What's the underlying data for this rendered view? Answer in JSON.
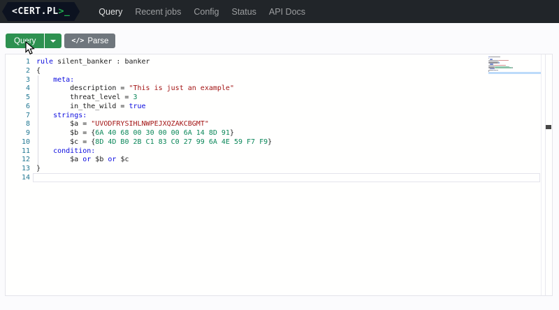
{
  "navbar": {
    "logo": {
      "prefix": "<",
      "brand": "CERT.PL",
      "suffix": ">",
      "cursor_char": "_"
    },
    "links": [
      {
        "label": "Query",
        "active": true
      },
      {
        "label": "Recent jobs",
        "active": false
      },
      {
        "label": "Config",
        "active": false
      },
      {
        "label": "Status",
        "active": false
      },
      {
        "label": "API Docs",
        "active": false
      }
    ]
  },
  "toolbar": {
    "query_label": "Query",
    "parse_label": "Parse",
    "parse_icon": "</>"
  },
  "colors": {
    "navbar_bg": "#212529",
    "logo_bg": "#0c1220",
    "logo_accent_green": "#1fae4e",
    "query_button_green": "#2d9150",
    "parse_button_gray": "#6f767d",
    "keyword": "#0a0adf",
    "string": "#a31515",
    "number": "#098658",
    "line_number": "#237893"
  },
  "editor": {
    "language": "yara",
    "line_count": 14,
    "lines": [
      {
        "n": 1,
        "tokens": [
          {
            "t": "rule",
            "c": "kw"
          },
          {
            "t": " silent_banker : banker",
            "c": "def"
          }
        ]
      },
      {
        "n": 2,
        "tokens": [
          {
            "t": "{",
            "c": "def"
          }
        ]
      },
      {
        "n": 3,
        "tokens": [
          {
            "t": "    ",
            "c": "def"
          },
          {
            "t": "meta:",
            "c": "kw"
          }
        ]
      },
      {
        "n": 4,
        "tokens": [
          {
            "t": "        description = ",
            "c": "def"
          },
          {
            "t": "\"This is just an example\"",
            "c": "str"
          }
        ]
      },
      {
        "n": 5,
        "tokens": [
          {
            "t": "        threat_level = ",
            "c": "def"
          },
          {
            "t": "3",
            "c": "num"
          }
        ]
      },
      {
        "n": 6,
        "tokens": [
          {
            "t": "        in_the_wild = ",
            "c": "def"
          },
          {
            "t": "true",
            "c": "kw"
          }
        ]
      },
      {
        "n": 7,
        "tokens": [
          {
            "t": "    ",
            "c": "def"
          },
          {
            "t": "strings:",
            "c": "kw"
          }
        ]
      },
      {
        "n": 8,
        "tokens": [
          {
            "t": "        $a = ",
            "c": "def"
          },
          {
            "t": "\"UVODFRYSIHLNWPEJXQZAKCBGMT\"",
            "c": "str"
          }
        ]
      },
      {
        "n": 9,
        "tokens": [
          {
            "t": "        $b = {",
            "c": "def"
          },
          {
            "t": "6A 40 68 00 30 00 00 6A 14 8D 91",
            "c": "num"
          },
          {
            "t": "}",
            "c": "def"
          }
        ]
      },
      {
        "n": 10,
        "tokens": [
          {
            "t": "        $c = {",
            "c": "def"
          },
          {
            "t": "8D 4D B0 2B C1 83 C0 27 99 6A 4E 59 F7 F9",
            "c": "num"
          },
          {
            "t": "}",
            "c": "def"
          }
        ]
      },
      {
        "n": 11,
        "tokens": [
          {
            "t": "    ",
            "c": "def"
          },
          {
            "t": "condition:",
            "c": "kw"
          }
        ]
      },
      {
        "n": 12,
        "tokens": [
          {
            "t": "        $a ",
            "c": "def"
          },
          {
            "t": "or",
            "c": "kw"
          },
          {
            "t": " $b ",
            "c": "def"
          },
          {
            "t": "or",
            "c": "kw"
          },
          {
            "t": " $c",
            "c": "def"
          }
        ]
      },
      {
        "n": 13,
        "tokens": [
          {
            "t": "}",
            "c": "def"
          }
        ]
      },
      {
        "n": 14,
        "tokens": [],
        "current": true
      }
    ]
  }
}
